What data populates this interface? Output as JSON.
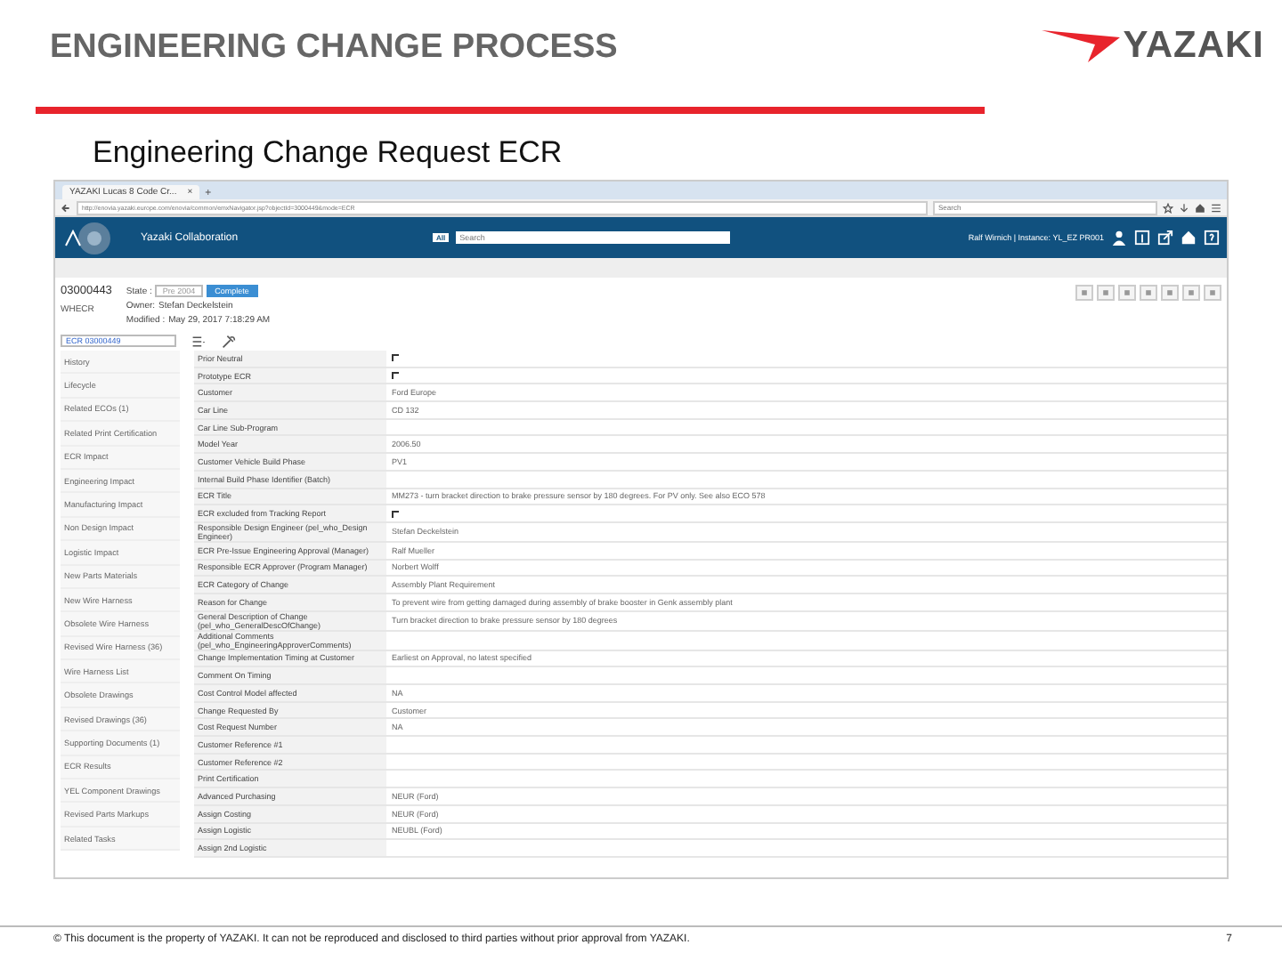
{
  "slide": {
    "title": "ENGINEERING CHANGE PROCESS",
    "logo": "YAZAKI",
    "subtitle": "Engineering Change Request ECR",
    "footer": "© This document is the property of YAZAKI. It can not be reproduced and disclosed to third parties without prior approval from YAZAKI.",
    "page_number": "7"
  },
  "browser": {
    "tab_title": "YAZAKI Lucas 8 Code Cr...",
    "tab_close": "×",
    "new_tab": "+",
    "url": "http://enovia.yazaki.europe.com/enovia/common/emxNavigator.jsp?objectId=3000449&mode=ECR",
    "search": {
      "placeholder": "Search"
    }
  },
  "app": {
    "title": "Yazaki Collaboration",
    "search_scope": "All",
    "search": {
      "placeholder": "Search"
    },
    "user": "Ralf Wirnich | Instance: YL_EZ PR001"
  },
  "object": {
    "number": "03000443",
    "type": "WHECR",
    "state_label": "State :",
    "state": "Pre 2004",
    "complete_button": "Complete",
    "owner_label": "Owner:",
    "owner": "Stefan Deckelstein",
    "modified_label": "Modified :",
    "modified": "May 29, 2017 7:18:29 AM"
  },
  "nav_field": "ECR 03000449",
  "nav_items": [
    {
      "label": "History",
      "selected": false
    },
    {
      "label": "Lifecycle",
      "selected": false
    },
    {
      "label": "Related ECOs (1)",
      "selected": false
    },
    {
      "label": "Related Print Certification",
      "selected": false
    },
    {
      "label": "ECR Impact",
      "selected": false
    },
    {
      "label": "Engineering Impact",
      "selected": false
    },
    {
      "label": "Manufacturing Impact",
      "selected": false
    },
    {
      "label": "Non Design Impact",
      "selected": false
    },
    {
      "label": "Logistic Impact",
      "selected": false
    },
    {
      "label": "New Parts Materials",
      "selected": false
    },
    {
      "label": "New Wire Harness",
      "selected": false
    },
    {
      "label": "Obsolete Wire Harness",
      "selected": false
    },
    {
      "label": "Revised Wire Harness (36)",
      "selected": false
    },
    {
      "label": "Wire Harness List",
      "selected": false
    },
    {
      "label": "Obsolete Drawings",
      "selected": false
    },
    {
      "label": "Revised Drawings (36)",
      "selected": false
    },
    {
      "label": "Supporting Documents (1)",
      "selected": false
    },
    {
      "label": "ECR Results",
      "selected": false
    },
    {
      "label": "YEL Component Drawings",
      "selected": false
    },
    {
      "label": "Revised Parts Markups",
      "selected": false
    },
    {
      "label": "Related Tasks",
      "selected": false
    }
  ],
  "fields": [
    {
      "label": "Prior Neutral",
      "kind": "checkbox",
      "checked": false
    },
    {
      "label": "Prototype ECR",
      "kind": "checkbox",
      "checked": false
    },
    {
      "label": "Customer",
      "kind": "text",
      "value": "Ford Europe"
    },
    {
      "label": "Car Line",
      "kind": "text",
      "value": "CD 132"
    },
    {
      "label": "Car Line Sub-Program",
      "kind": "text"
    },
    {
      "label": "Model Year",
      "kind": "text",
      "value": "2006.50"
    },
    {
      "label": "Customer Vehicle Build Phase",
      "kind": "text",
      "value": "PV1"
    },
    {
      "label": "Internal Build Phase Identifier (Batch)",
      "kind": "text"
    },
    {
      "label": "ECR Title",
      "kind": "text",
      "value": "MM273 - turn bracket direction to brake pressure sensor by 180 degrees. For PV only. See also ECO 578"
    },
    {
      "label": "ECR excluded from Tracking Report",
      "kind": "checkbox",
      "checked": false
    },
    {
      "label": "Responsible Design Engineer (pel_who_Design Engineer)",
      "kind": "text",
      "value": "Stefan Deckelstein"
    },
    {
      "label": "ECR Pre-Issue Engineering Approval (Manager)",
      "kind": "text",
      "value": "Ralf Mueller"
    },
    {
      "label": "Responsible ECR Approver (Program Manager)",
      "kind": "text",
      "value": "Norbert Wolff"
    },
    {
      "label": "ECR Category of Change",
      "kind": "text",
      "value": "Assembly Plant Requirement"
    },
    {
      "label": "Reason for Change",
      "kind": "text",
      "value": "To prevent wire from getting damaged during assembly of brake booster in Genk assembly plant"
    },
    {
      "label": "General Description of Change (pel_who_GeneralDescOfChange)",
      "kind": "text",
      "value": "Turn bracket direction to brake pressure sensor by 180 degrees"
    },
    {
      "label": "Additional Comments (pel_who_EngineeringApproverComments)",
      "kind": "text"
    },
    {
      "label": "Change Implementation Timing at Customer",
      "kind": "text",
      "value": "Earliest on Approval, no latest specified"
    },
    {
      "label": "Comment On Timing",
      "kind": "text"
    },
    {
      "label": "Cost Control Model affected",
      "kind": "text",
      "value": "NA"
    },
    {
      "label": "Change Requested By",
      "kind": "text",
      "value": "Customer"
    },
    {
      "label": "Cost Request Number",
      "kind": "text",
      "value": "NA"
    },
    {
      "label": "Customer Reference #1",
      "kind": "text"
    },
    {
      "label": "Customer Reference #2",
      "kind": "text"
    },
    {
      "label": "Print Certification",
      "kind": "text"
    },
    {
      "label": "Advanced Purchasing",
      "kind": "text",
      "value": "NEUR (Ford)"
    },
    {
      "label": "Assign Costing",
      "kind": "text",
      "value": "NEUR (Ford)"
    },
    {
      "label": "Assign Logistic",
      "kind": "text",
      "value": "NEUBL (Ford)"
    },
    {
      "label": "Assign 2nd Logistic",
      "kind": "text"
    }
  ]
}
